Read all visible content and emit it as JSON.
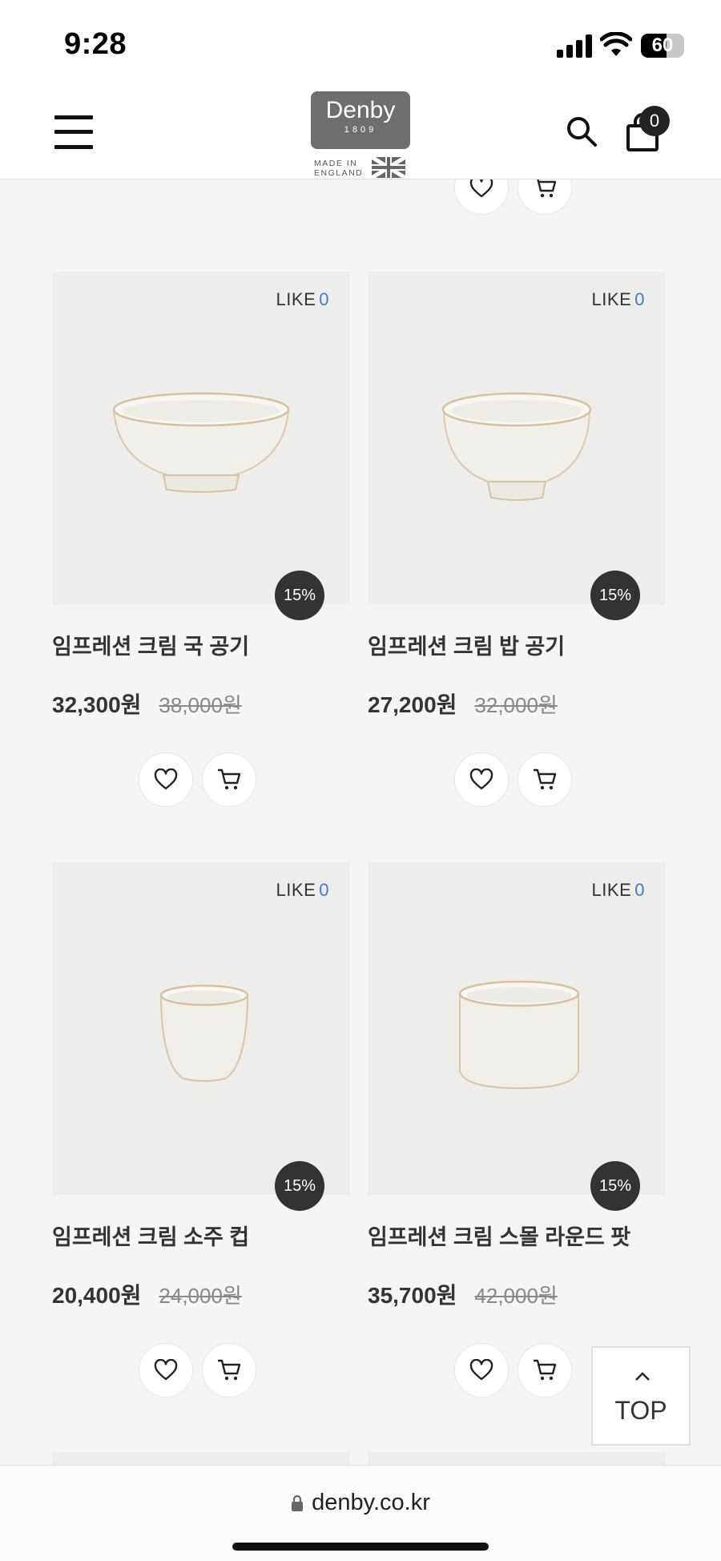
{
  "status_bar": {
    "time": "9:28",
    "battery": "60"
  },
  "header": {
    "logo_name": "Denby",
    "logo_year": "1809",
    "logo_made_line1": "MADE IN",
    "logo_made_line2": "ENGLAND",
    "cart_count": "0"
  },
  "products": [
    {
      "name": "임프레션 크림 국 공기",
      "price": "32,300원",
      "original_price": "38,000원",
      "discount": "15%",
      "like_label": "LIKE",
      "like_count": "0"
    },
    {
      "name": "임프레션 크림 밥 공기",
      "price": "27,200원",
      "original_price": "32,000원",
      "discount": "15%",
      "like_label": "LIKE",
      "like_count": "0"
    },
    {
      "name": "임프레션 크림 소주 컵",
      "price": "20,400원",
      "original_price": "24,000원",
      "discount": "15%",
      "like_label": "LIKE",
      "like_count": "0"
    },
    {
      "name": "임프레션 크림 스몰 라운드 팟",
      "price": "35,700원",
      "original_price": "42,000원",
      "discount": "15%",
      "like_label": "LIKE",
      "like_count": "0"
    }
  ],
  "top_button": {
    "label": "TOP"
  },
  "browser": {
    "url": "denby.co.kr"
  },
  "colors": {
    "like_count": "#3e7bd6",
    "badge_bg": "#333333",
    "logo_bg": "#6d6e70",
    "image_bg": "#ededec"
  }
}
